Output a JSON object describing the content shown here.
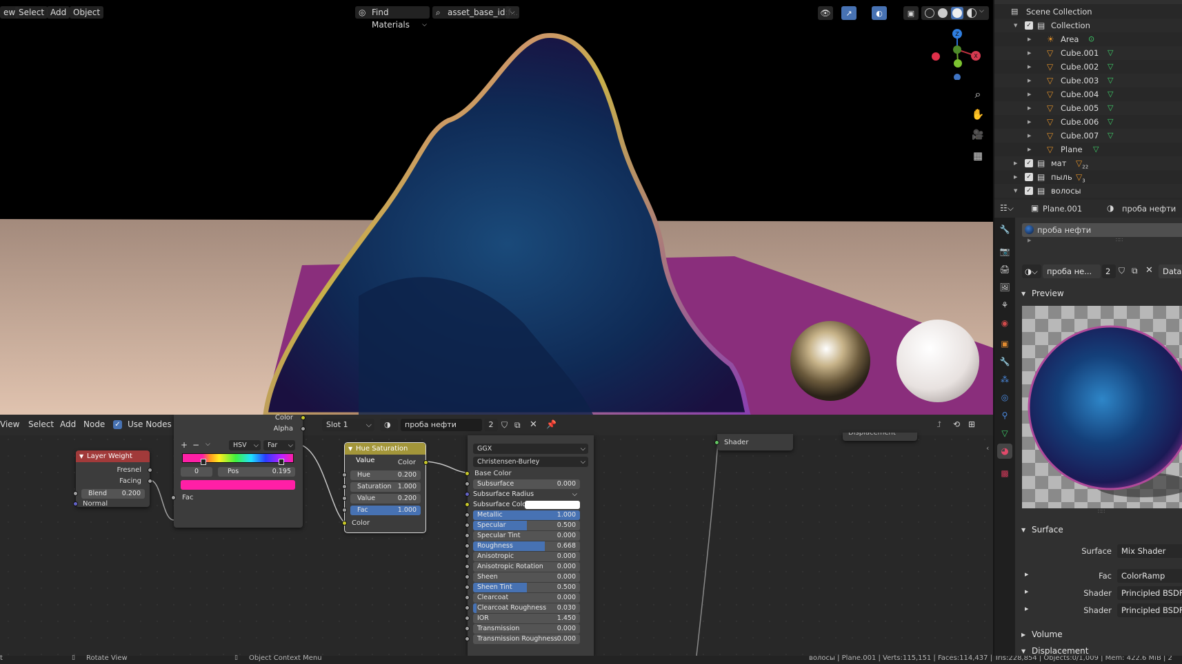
{
  "viewport": {
    "menu": [
      "ew",
      "Select",
      "Add",
      "Object"
    ],
    "find_materials": "Find Materials",
    "asset_label": "asset_base_id:f..."
  },
  "node_editor": {
    "menu": [
      "View",
      "Select",
      "Add",
      "Node"
    ],
    "use_nodes_label": "Use Nodes",
    "slot": "Slot 1",
    "material_name": "проба нефти",
    "users": "2",
    "layer_weight": {
      "title": "Layer Weight",
      "fresnel": "Fresnel",
      "facing": "Facing",
      "blend_label": "Blend",
      "blend_value": "0.200",
      "normal": "Normal"
    },
    "color_ramp": {
      "top_label_color": "Color",
      "top_label_alpha": "Alpha",
      "plus": "+",
      "minus": "−",
      "mode": "HSV",
      "interp": "Far",
      "index": "0",
      "pos_label": "Pos",
      "pos_value": "0.195",
      "fac": "Fac",
      "color": "#ff1fa6"
    },
    "hsv_node": {
      "title": "Hue Saturation Value",
      "out_color": "Color",
      "hue_label": "Hue",
      "hue": "0.200",
      "sat_label": "Saturation",
      "sat": "1.000",
      "val_label": "Value",
      "val": "0.200",
      "fac_label": "Fac",
      "fac": "1.000",
      "fac_fraction": 1.0,
      "in_color": "Color"
    },
    "bsdf": {
      "distribution": "GGX",
      "subsurface_method": "Christensen-Burley",
      "base_color": "Base Color",
      "rows": [
        {
          "label": "Subsurface",
          "value": "0.000",
          "fill": 0.0
        },
        {
          "label": "Subsurface Radius",
          "value": "",
          "fill": 0.0,
          "dropdown": true
        },
        {
          "label": "Subsurface Color",
          "value": "",
          "fill": 0.0,
          "swatch": "#ffffff"
        },
        {
          "label": "Metallic",
          "value": "1.000",
          "fill": 1.0
        },
        {
          "label": "Specular",
          "value": "0.500",
          "fill": 0.5
        },
        {
          "label": "Specular Tint",
          "value": "0.000",
          "fill": 0.0
        },
        {
          "label": "Roughness",
          "value": "0.668",
          "fill": 0.668
        },
        {
          "label": "Anisotropic",
          "value": "0.000",
          "fill": 0.0
        },
        {
          "label": "Anisotropic Rotation",
          "value": "0.000",
          "fill": 0.0
        },
        {
          "label": "Sheen",
          "value": "0.000",
          "fill": 0.0
        },
        {
          "label": "Sheen Tint",
          "value": "0.500",
          "fill": 0.5
        },
        {
          "label": "Clearcoat",
          "value": "0.000",
          "fill": 0.0
        },
        {
          "label": "Clearcoat Roughness",
          "value": "0.030",
          "fill": 0.03
        },
        {
          "label": "IOR",
          "value": "1.450",
          "fill": 0.0
        },
        {
          "label": "Transmission",
          "value": "0.000",
          "fill": 0.0
        },
        {
          "label": "Transmission Roughness",
          "value": "0.000",
          "fill": 0.0
        }
      ]
    },
    "output_node": {
      "shader": "Shader",
      "displacement": "Displacement"
    }
  },
  "status_bar": {
    "left_key": "t",
    "rotate_view": "Rotate View",
    "context_menu": "Object Context Menu",
    "stats": "волосы | Plane.001 | Verts:115,151 | Faces:114,437 | Tris:228,854 | Objects:0/1,009 | Mem: 422.6 MiB | 2"
  },
  "outliner": {
    "root": "Scene Collection",
    "items": [
      {
        "label": "Collection",
        "indent": 0,
        "kind": "collection",
        "expanded": true
      },
      {
        "label": "Area",
        "indent": 1,
        "kind": "light"
      },
      {
        "label": "Cube.001",
        "indent": 1,
        "kind": "mesh"
      },
      {
        "label": "Cube.002",
        "indent": 1,
        "kind": "mesh"
      },
      {
        "label": "Cube.003",
        "indent": 1,
        "kind": "mesh"
      },
      {
        "label": "Cube.004",
        "indent": 1,
        "kind": "mesh"
      },
      {
        "label": "Cube.005",
        "indent": 1,
        "kind": "mesh"
      },
      {
        "label": "Cube.006",
        "indent": 1,
        "kind": "mesh"
      },
      {
        "label": "Cube.007",
        "indent": 1,
        "kind": "mesh"
      },
      {
        "label": "Plane",
        "indent": 1,
        "kind": "mesh"
      },
      {
        "label": "мат",
        "indent": 0,
        "kind": "collection",
        "badge": "22"
      },
      {
        "label": "пыль",
        "indent": 0,
        "kind": "collection",
        "badge": "3"
      },
      {
        "label": "волосы",
        "indent": 0,
        "kind": "collection",
        "expanded": true
      }
    ]
  },
  "properties": {
    "object_name": "Plane.001",
    "material_name": "проба нефти",
    "slot_item": "проба нефти",
    "material_short": "проба не...",
    "users": "2",
    "data_btn": "Data",
    "preview_title": "Preview",
    "surface_title": "Surface",
    "surface_rows": [
      {
        "label": "Surface",
        "value": "Mix Shader"
      },
      {
        "label": "Fac",
        "value": "ColorRamp"
      },
      {
        "label": "Shader",
        "value": "Principled BSDF"
      },
      {
        "label": "Shader",
        "value": "Principled BSDF"
      }
    ],
    "volume_title": "Volume",
    "displacement_title": "Displacement"
  }
}
